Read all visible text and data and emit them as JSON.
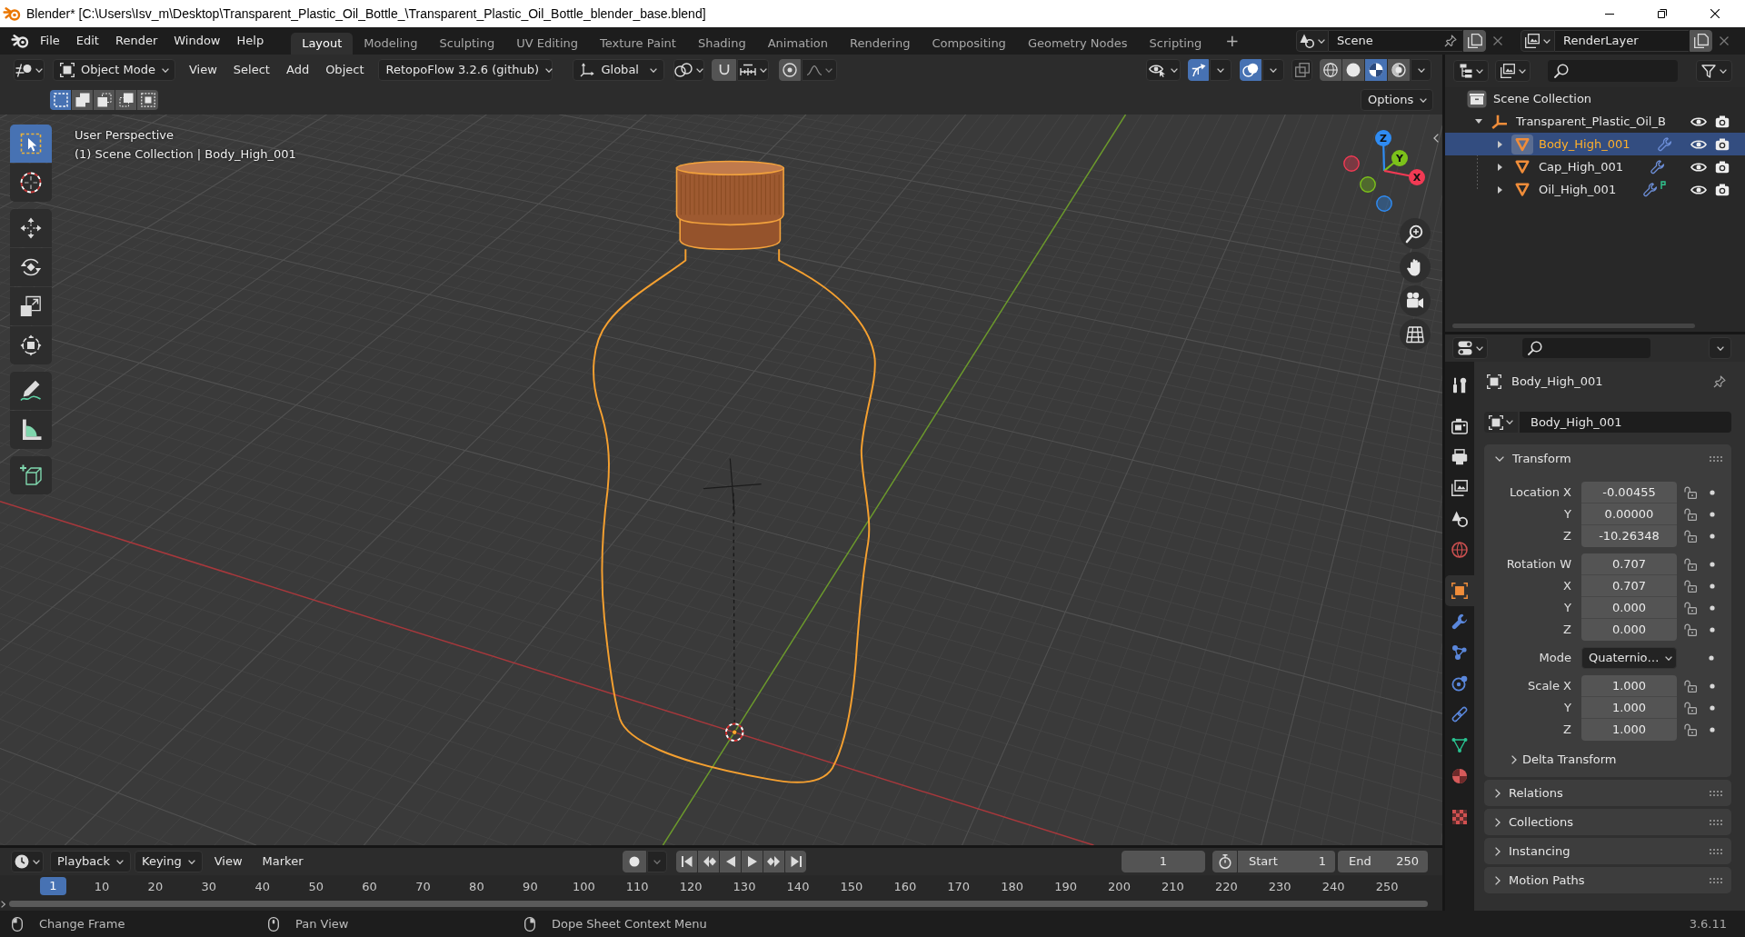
{
  "window": {
    "title": "Blender* [C:\\Users\\Isv_m\\Desktop\\Transparent_Plastic_Oil_Bottle_\\Transparent_Plastic_Oil_Bottle_blender_base.blend]"
  },
  "top_bar": {
    "menus": [
      "File",
      "Edit",
      "Render",
      "Window",
      "Help"
    ],
    "workspaces": [
      {
        "label": "Layout",
        "selected": true
      },
      {
        "label": "Modeling",
        "selected": false
      },
      {
        "label": "Sculpting",
        "selected": false
      },
      {
        "label": "UV Editing",
        "selected": false
      },
      {
        "label": "Texture Paint",
        "selected": false
      },
      {
        "label": "Shading",
        "selected": false
      },
      {
        "label": "Animation",
        "selected": false
      },
      {
        "label": "Rendering",
        "selected": false
      },
      {
        "label": "Compositing",
        "selected": false
      },
      {
        "label": "Geometry Nodes",
        "selected": false
      },
      {
        "label": "Scripting",
        "selected": false
      }
    ],
    "add_workspace": "+",
    "scene": "Scene",
    "view_layer": "RenderLayer"
  },
  "viewport": {
    "header": {
      "mode": "Object Mode",
      "menus": [
        "View",
        "Select",
        "Add",
        "Object"
      ],
      "addon_menu": "RetopoFlow 3.2.6 (github)",
      "orientation": "Global",
      "snap_on": false,
      "proportional_on": false,
      "gizmos_on": true,
      "overlays_on": true,
      "xray_on": false,
      "shading": [
        {
          "kind": "wireframe",
          "selected": false
        },
        {
          "kind": "solid",
          "selected": false
        },
        {
          "kind": "material",
          "selected": true
        },
        {
          "kind": "rendered",
          "selected": false
        }
      ]
    },
    "select_modes": [
      {
        "kind": "set",
        "selected": true
      },
      {
        "kind": "extend",
        "selected": false
      },
      {
        "kind": "subtract",
        "selected": false
      },
      {
        "kind": "invert",
        "selected": false
      },
      {
        "kind": "intersect",
        "selected": false
      }
    ],
    "options": "Options",
    "tool_groups": [
      {
        "tools": [
          {
            "kind": "select_box",
            "selected": true
          },
          {
            "kind": "cursor",
            "selected": false
          }
        ]
      },
      {
        "tools": [
          {
            "kind": "move",
            "selected": false
          },
          {
            "kind": "rotate",
            "selected": false
          },
          {
            "kind": "scale",
            "selected": false
          },
          {
            "kind": "transform",
            "selected": false
          }
        ]
      },
      {
        "tools": [
          {
            "kind": "annotate",
            "selected": false
          },
          {
            "kind": "measure",
            "selected": false
          }
        ]
      },
      {
        "tools": [
          {
            "kind": "add_cube",
            "selected": false
          }
        ]
      }
    ],
    "info": [
      "User Perspective",
      "(1) Scene Collection | Body_High_001"
    ],
    "gizmo_axes": [
      {
        "kind": "z",
        "label": "Z",
        "color": "#2f8cf3"
      },
      {
        "kind": "y",
        "label": "Y",
        "color": "#7cc21a"
      },
      {
        "kind": "x",
        "label": "X",
        "color": "#f13a54"
      }
    ]
  },
  "outliner": {
    "tree": [
      {
        "label": "Scene Collection",
        "kind": "scene_collection",
        "selected": false,
        "children": [
          {
            "label": "Transparent_Plastic_Oil_B",
            "kind": "empty",
            "expanded": true,
            "selected": false,
            "visible": true,
            "renderable": true,
            "children": [
              {
                "label": "Body_High_001",
                "kind": "mesh",
                "expanded": false,
                "selected": true,
                "visible": true,
                "renderable": true,
                "badges": [
                  {
                    "kind": "modifier"
                  }
                ]
              },
              {
                "label": "Cap_High_001",
                "kind": "mesh",
                "expanded": false,
                "selected": false,
                "visible": true,
                "renderable": true,
                "badges": [
                  {
                    "kind": "modifier"
                  }
                ]
              },
              {
                "label": "Oil_High_001",
                "kind": "mesh",
                "expanded": false,
                "selected": false,
                "visible": true,
                "renderable": true,
                "badges": [
                  {
                    "kind": "modifier"
                  },
                  {
                    "kind": "vertex_group"
                  }
                ]
              }
            ]
          }
        ]
      }
    ]
  },
  "properties": {
    "tab_groups": [
      {
        "tabs": [
          {
            "kind": "tool",
            "selected": false
          }
        ]
      },
      {
        "tabs": [
          {
            "kind": "render",
            "selected": false
          },
          {
            "kind": "output",
            "selected": false
          },
          {
            "kind": "view_layer",
            "selected": false
          },
          {
            "kind": "scene",
            "selected": false
          },
          {
            "kind": "world",
            "selected": false
          }
        ]
      },
      {
        "tabs": [
          {
            "kind": "object",
            "selected": true
          },
          {
            "kind": "modifiers",
            "selected": false
          },
          {
            "kind": "particles",
            "selected": false
          },
          {
            "kind": "physics",
            "selected": false
          },
          {
            "kind": "constraints",
            "selected": false
          },
          {
            "kind": "data",
            "selected": false
          },
          {
            "kind": "material",
            "selected": false
          }
        ]
      },
      {
        "tabs": [
          {
            "kind": "texture",
            "selected": false
          }
        ]
      }
    ],
    "object_name": "Body_High_001",
    "datablock": "Body_High_001",
    "panels": [
      {
        "title": "Transform",
        "expanded": true,
        "groups": [
          {
            "rows": [
              {
                "kind": "number",
                "label": "Location X",
                "value": "-0.00455",
                "locked": false
              },
              {
                "kind": "number",
                "label": "Y",
                "value": "0.00000",
                "locked": false
              },
              {
                "kind": "number",
                "label": "Z",
                "value": "-10.26348",
                "locked": false
              }
            ]
          },
          {
            "rows": [
              {
                "kind": "number",
                "label": "Rotation W",
                "value": "0.707",
                "locked": false
              },
              {
                "kind": "number",
                "label": "X",
                "value": "0.707",
                "locked": false
              },
              {
                "kind": "number",
                "label": "Y",
                "value": "0.000",
                "locked": false
              },
              {
                "kind": "number",
                "label": "Z",
                "value": "0.000",
                "locked": false
              }
            ]
          },
          {
            "rows": [
              {
                "kind": "dropdown",
                "label": "Mode",
                "value": "Quaternio…"
              }
            ]
          },
          {
            "rows": [
              {
                "kind": "number",
                "label": "Scale X",
                "value": "1.000",
                "locked": false
              },
              {
                "kind": "number",
                "label": "Y",
                "value": "1.000",
                "locked": false
              },
              {
                "kind": "number",
                "label": "Z",
                "value": "1.000",
                "locked": false
              }
            ]
          }
        ],
        "subpanels": [
          {
            "title": "Delta Transform",
            "expanded": false
          }
        ]
      },
      {
        "title": "Relations",
        "expanded": false
      },
      {
        "title": "Collections",
        "expanded": false
      },
      {
        "title": "Instancing",
        "expanded": false
      },
      {
        "title": "Motion Paths",
        "expanded": false
      }
    ]
  },
  "timeline": {
    "menus": [
      {
        "kind": "dropdown",
        "label": "Playback"
      },
      {
        "kind": "dropdown",
        "label": "Keying"
      },
      {
        "kind": "menu",
        "label": "View"
      },
      {
        "kind": "menu",
        "label": "Marker"
      }
    ],
    "auto_keying": false,
    "current_frame": "1",
    "preview_range_on": false,
    "start_label": "Start",
    "start": "1",
    "end_label": "End",
    "end": "250",
    "ruler": {
      "playhead": "1",
      "ticks": [
        "10",
        "20",
        "30",
        "40",
        "50",
        "60",
        "70",
        "80",
        "90",
        "100",
        "110",
        "120",
        "130",
        "140",
        "150",
        "160",
        "170",
        "180",
        "190",
        "200",
        "210",
        "220",
        "230",
        "240",
        "250"
      ]
    }
  },
  "status_bar": {
    "hints": [
      {
        "kind": "left_click",
        "label": "Change Frame"
      },
      {
        "kind": "middle_click",
        "label": "Pan View"
      },
      {
        "kind": "right_click",
        "label": "Dope Sheet Context Menu"
      }
    ],
    "version": "3.6.11"
  }
}
